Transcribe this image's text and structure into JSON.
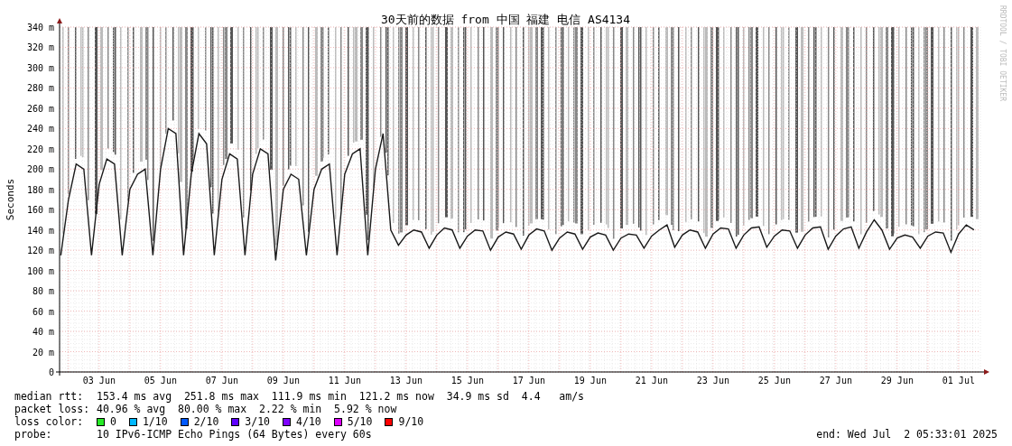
{
  "chart": {
    "title": "30天前的数据 from 中国 福建 电信 AS4134",
    "side_text": "RRDTOOL / TOBI OETIKER",
    "chart_data": {
      "type": "line",
      "grid": true,
      "ylabel": "Seconds",
      "ylim": [
        0,
        340
      ],
      "yticks": [
        {
          "value": 0,
          "label": "0"
        },
        {
          "value": 20,
          "label": "20 m"
        },
        {
          "value": 40,
          "label": "40 m"
        },
        {
          "value": 60,
          "label": "60 m"
        },
        {
          "value": 80,
          "label": "80 m"
        },
        {
          "value": 100,
          "label": "100 m"
        },
        {
          "value": 120,
          "label": "120 m"
        },
        {
          "value": 140,
          "label": "140 m"
        },
        {
          "value": 160,
          "label": "160 m"
        },
        {
          "value": 180,
          "label": "180 m"
        },
        {
          "value": 200,
          "label": "200 m"
        },
        {
          "value": 220,
          "label": "220 m"
        },
        {
          "value": 240,
          "label": "240 m"
        },
        {
          "value": 260,
          "label": "260 m"
        },
        {
          "value": 280,
          "label": "280 m"
        },
        {
          "value": 300,
          "label": "300 m"
        },
        {
          "value": 320,
          "label": "320 m"
        },
        {
          "value": 340,
          "label": "340 m"
        }
      ],
      "categories": [
        null,
        null,
        null,
        null,
        null,
        "03 Jun",
        null,
        null,
        null,
        null,
        null,
        null,
        null,
        "05 Jun",
        null,
        null,
        null,
        null,
        null,
        null,
        null,
        "07 Jun",
        null,
        null,
        null,
        null,
        null,
        null,
        null,
        "09 Jun",
        null,
        null,
        null,
        null,
        null,
        null,
        null,
        "11 Jun",
        null,
        null,
        null,
        null,
        null,
        null,
        null,
        "13 Jun",
        null,
        null,
        null,
        null,
        null,
        null,
        null,
        "15 Jun",
        null,
        null,
        null,
        null,
        null,
        null,
        null,
        "17 Jun",
        null,
        null,
        null,
        null,
        null,
        null,
        null,
        "19 Jun",
        null,
        null,
        null,
        null,
        null,
        null,
        null,
        "21 Jun",
        null,
        null,
        null,
        null,
        null,
        null,
        null,
        "23 Jun",
        null,
        null,
        null,
        null,
        null,
        null,
        null,
        "25 Jun",
        null,
        null,
        null,
        null,
        null,
        null,
        null,
        "27 Jun",
        null,
        null,
        null,
        null,
        null,
        null,
        null,
        "29 Jun",
        null,
        null,
        null,
        null,
        null,
        null,
        null,
        "01 Jul",
        null,
        null
      ],
      "series": [
        {
          "color": "#1a1a1a",
          "values": [
            115,
            170,
            205,
            200,
            115,
            185,
            210,
            205,
            115,
            180,
            195,
            200,
            115,
            200,
            240,
            235,
            115,
            195,
            235,
            225,
            115,
            190,
            215,
            210,
            115,
            195,
            220,
            215,
            110,
            180,
            195,
            190,
            115,
            180,
            200,
            205,
            115,
            195,
            215,
            220,
            115,
            200,
            235,
            140,
            125,
            135,
            140,
            138,
            122,
            135,
            142,
            140,
            122,
            134,
            140,
            139,
            120,
            133,
            138,
            136,
            121,
            135,
            141,
            139,
            120,
            132,
            138,
            136,
            121,
            133,
            137,
            135,
            120,
            132,
            136,
            135,
            122,
            134,
            140,
            145,
            123,
            135,
            140,
            138,
            122,
            136,
            142,
            141,
            122,
            135,
            142,
            143,
            123,
            134,
            140,
            139,
            122,
            135,
            142,
            143,
            121,
            134,
            141,
            143,
            122,
            138,
            150,
            140,
            121,
            132,
            135,
            133,
            122,
            134,
            138,
            137,
            118,
            136,
            145,
            140
          ]
        }
      ]
    }
  },
  "legend": {
    "median_rtt": {
      "label": "median rtt:",
      "text": "153.4 ms avg  251.8 ms max  111.9 ms min  121.2 ms now  34.9 ms sd  4.4   am/s"
    },
    "packet_loss": {
      "label": "packet loss:",
      "text": "40.96 % avg  80.00 % max  2.22 % min  5.92 % now"
    },
    "loss_color": {
      "label": "loss color:",
      "items": [
        {
          "label": "0",
          "color": "#26ea26"
        },
        {
          "label": "1/10",
          "color": "#00b8ff"
        },
        {
          "label": "2/10",
          "color": "#0059ff"
        },
        {
          "label": "3/10",
          "color": "#5e00ff"
        },
        {
          "label": "4/10",
          "color": "#7e00ff"
        },
        {
          "label": "5/10",
          "color": "#dd00ff"
        },
        {
          "label": "9/10",
          "color": "#ff0000"
        }
      ]
    },
    "probe": {
      "label": "probe:",
      "text": "10 IPv6-ICMP Echo Pings (64 Bytes) every 60s"
    },
    "end": "end: Wed Jul  2 05:33:01 2025"
  }
}
